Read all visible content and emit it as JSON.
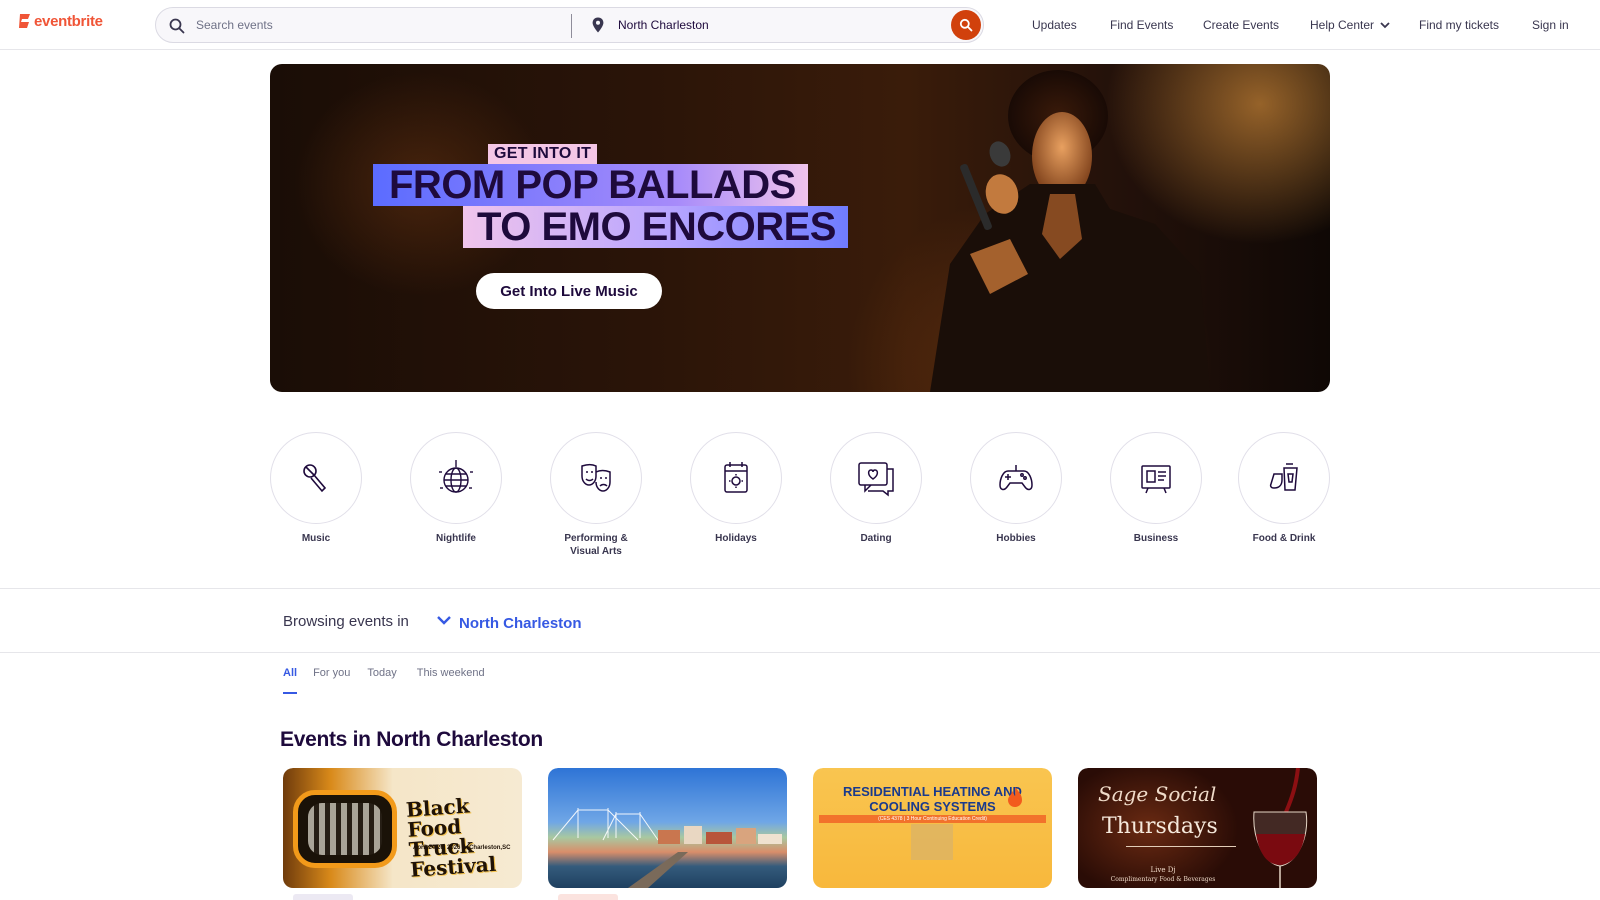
{
  "brand": {
    "name": "eventbrite",
    "color": "#f05537"
  },
  "search": {
    "placeholder": "Search events",
    "location": "North Charleston"
  },
  "nav": {
    "items": [
      "Updates",
      "Find Events",
      "Create Events",
      "Help Center",
      "Find my tickets",
      "Sign in"
    ]
  },
  "hero": {
    "kicker": "GET INTO IT",
    "line1": "FROM POP BALLADS",
    "line2": "TO EMO ENCORES",
    "cta": "Get Into Live Music"
  },
  "categories": [
    {
      "label": "Music",
      "icon": "microphone-icon"
    },
    {
      "label": "Nightlife",
      "icon": "disco-ball-icon"
    },
    {
      "label": "Performing & Visual Arts",
      "icon": "theater-masks-icon"
    },
    {
      "label": "Holidays",
      "icon": "calendar-sun-icon"
    },
    {
      "label": "Dating",
      "icon": "chat-heart-icon"
    },
    {
      "label": "Hobbies",
      "icon": "game-controller-icon"
    },
    {
      "label": "Business",
      "icon": "presentation-board-icon"
    },
    {
      "label": "Food & Drink",
      "icon": "drinks-icon"
    }
  ],
  "browse": {
    "label": "Browsing events in",
    "city": "North Charleston"
  },
  "tabs": [
    "All",
    "For you",
    "Today",
    "This weekend"
  ],
  "section_title": "Events in North Charleston",
  "events": [
    {
      "image_text": "Black Food Truck Festival",
      "image_subtext": "April 24-26, 2026 ★ Charleston,SC"
    },
    {
      "image_text": ""
    },
    {
      "image_text": "RESIDENTIAL HEATING AND COOLING SYSTEMS",
      "image_subtext": "(CES 4378 | 3 Hour Continuing Education Credit)"
    },
    {
      "image_text": "Sage Social",
      "image_subtext": "Thursdays",
      "image_note_1": "Live Dj",
      "image_note_2": "Complimentary Food & Beverages"
    }
  ],
  "colors": {
    "accent": "#3659e3",
    "search_button": "#d1410c",
    "text_dark": "#1e0a3c"
  }
}
